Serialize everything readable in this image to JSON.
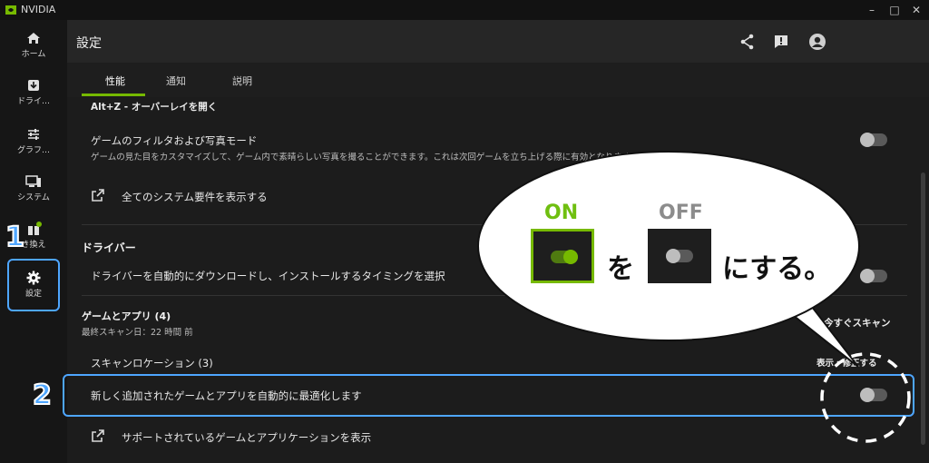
{
  "window": {
    "app_name": "NVIDIA",
    "minimize": "–",
    "maximize": "□",
    "close": "✕"
  },
  "sidebar": {
    "items": [
      {
        "label": "ホーム",
        "icon": "home-icon"
      },
      {
        "label": "ドライ…",
        "icon": "driver-download-icon"
      },
      {
        "label": "グラフ…",
        "icon": "sliders-icon"
      },
      {
        "label": "システム",
        "icon": "system-monitor-icon"
      },
      {
        "label": "き換え",
        "icon": "redeem-gift-icon"
      },
      {
        "label": "設定",
        "icon": "gear-icon"
      }
    ]
  },
  "header": {
    "title": "設定",
    "icons": [
      "share-icon",
      "feedback-icon",
      "profile-icon"
    ]
  },
  "tabs": [
    {
      "label": "性能"
    },
    {
      "label": "通知"
    },
    {
      "label": "説明"
    }
  ],
  "content": {
    "hotkey_label": "Alt+Z - オーバーレイを開く",
    "filter_mode": {
      "title": "ゲームのフィルタおよび写真モード",
      "description": "ゲームの見た目をカスタマイズして、ゲーム内で素晴らしい写真を撮ることができます。これは次回ゲームを立ち上げる際に有効となります。",
      "enabled": false
    },
    "system_requirements_link": "全てのシステム要件を表示する",
    "driver_section": {
      "title": "ドライバー",
      "auto_download_label": "ドライバーを自動的にダウンロードし、インストールするタイミングを選択",
      "enabled": false
    },
    "games_section": {
      "title": "ゲームとアプリ (4)",
      "last_scan": "最終スキャン日：22 時間 前",
      "scan_now": "今すぐスキャン",
      "scan_locations": "スキャンロケーション (3)",
      "show_and_edit": "表示・修正する",
      "auto_optimize_label": "新しく追加されたゲームとアプリを自動的に最適化します",
      "auto_optimize_enabled": false,
      "supported_link": "サポートされているゲームとアプリケーションを表示"
    }
  },
  "annotation": {
    "step1": "1",
    "step2": "2",
    "on_label": "ON",
    "off_label": "OFF",
    "particle": "を",
    "instruction_end": "にする。",
    "highlight_color": "#4ea6ff",
    "on_color": "#76b900"
  }
}
